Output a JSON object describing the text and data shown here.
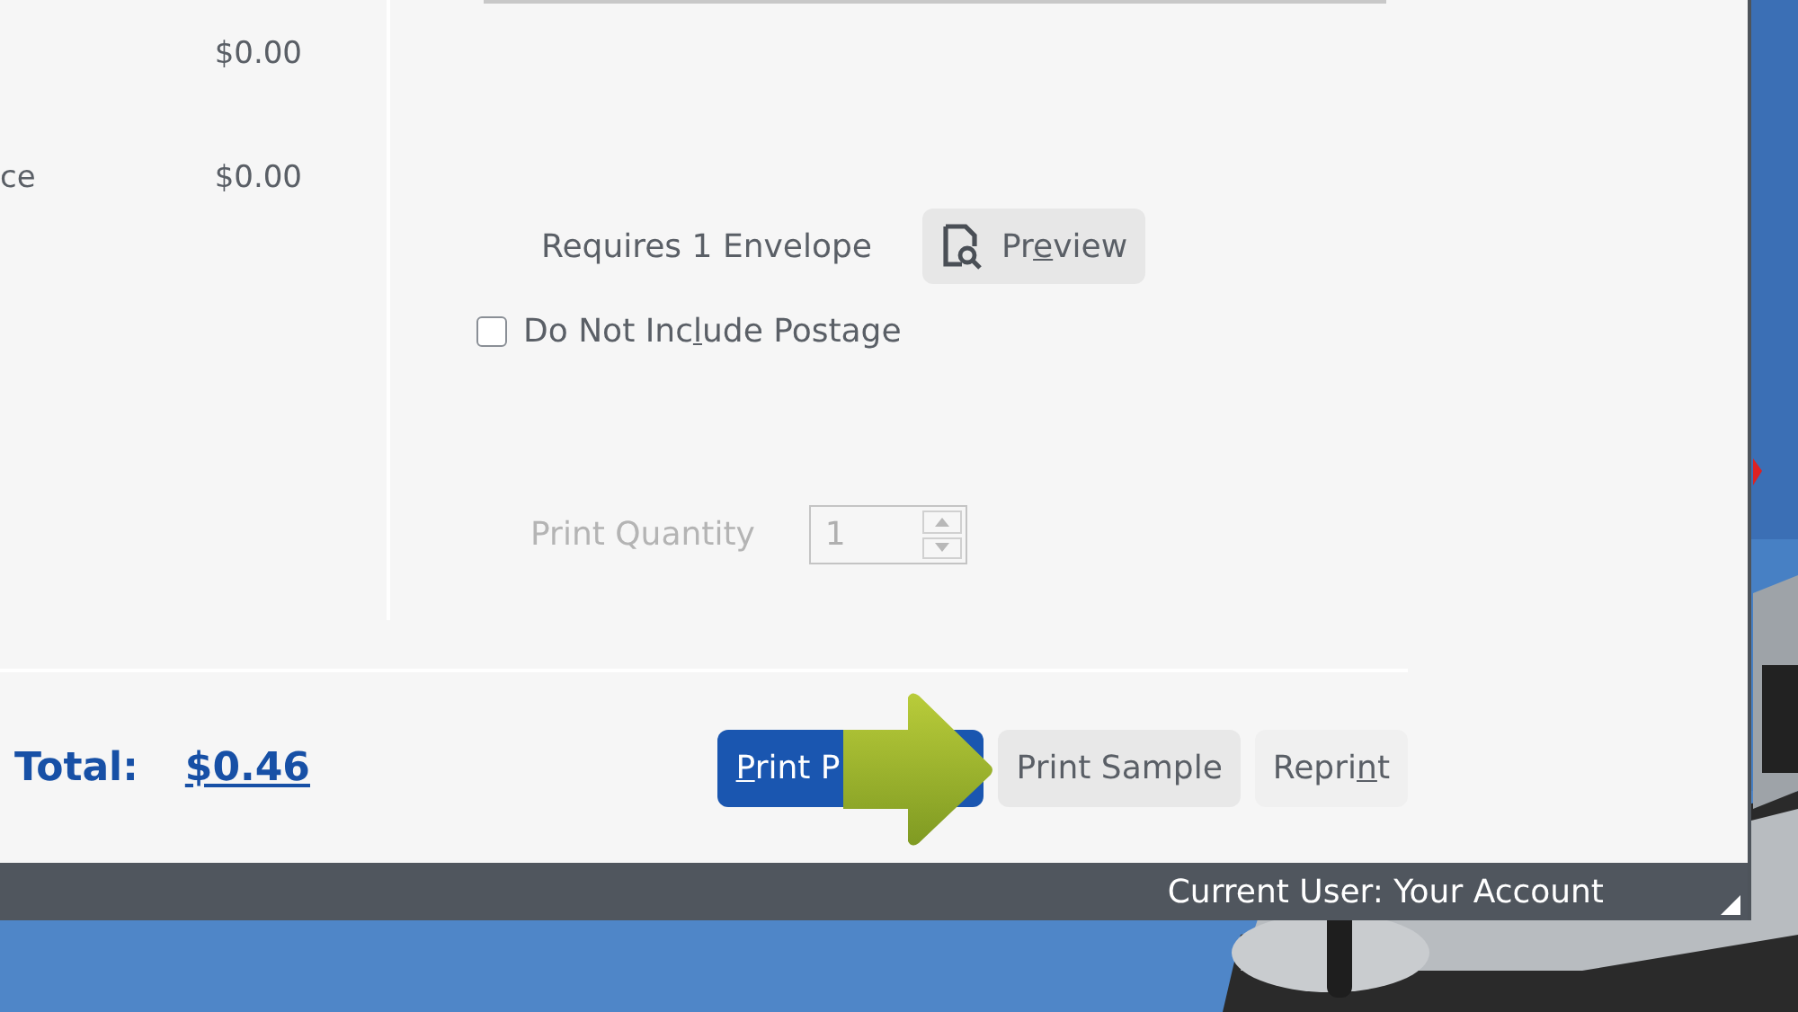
{
  "summary_rows": [
    {
      "amount": "$0.00"
    },
    {
      "label": "ce",
      "amount": "$0.00"
    }
  ],
  "envelope": {
    "requirement": "Requires 1 Envelope",
    "preview_button": {
      "before": "Pr",
      "key": "e",
      "after": "view"
    }
  },
  "postage_option": {
    "label": {
      "before": "Do Not Inc",
      "key": "l",
      "after": "ude Postage"
    },
    "checked": false
  },
  "print_quantity": {
    "label": "Print Quantity",
    "value": "1",
    "disabled": true
  },
  "total": {
    "label": "Total:",
    "amount": "$0.46"
  },
  "buttons": [
    {
      "kind": "primary",
      "label": {
        "key": "P",
        "after": "rint P"
      }
    },
    {
      "kind": "secondary",
      "label": {
        "before": "Print Sample"
      }
    },
    {
      "kind": "plain",
      "label": {
        "before": "Repri",
        "key": "n",
        "after": "t"
      }
    }
  ],
  "status_bar": {
    "user": "Current User: Your Account"
  }
}
